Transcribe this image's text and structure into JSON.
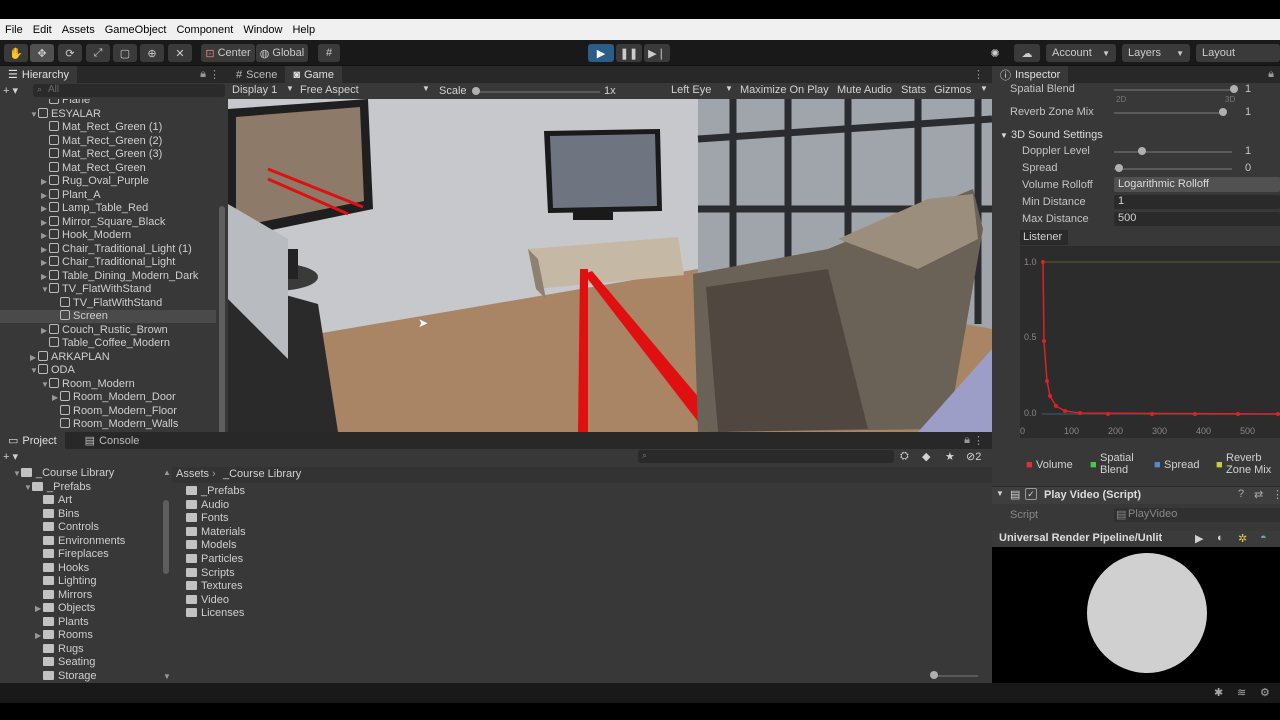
{
  "menu": {
    "items": [
      "File",
      "Edit",
      "Assets",
      "GameObject",
      "Component",
      "Window",
      "Help"
    ]
  },
  "toolbar": {
    "center_label": "Center",
    "global_label": "Global",
    "account_label": "Account",
    "layers_label": "Layers",
    "layout_label": "Layout"
  },
  "hierarchy": {
    "title": "Hierarchy",
    "search_placeholder": "All",
    "rows": [
      {
        "label": "Plane",
        "indent": 3,
        "arrow": ""
      },
      {
        "label": "ESYALAR",
        "indent": 2,
        "arrow": "▼"
      },
      {
        "label": "Mat_Rect_Green (1)",
        "indent": 3,
        "arrow": ""
      },
      {
        "label": "Mat_Rect_Green (2)",
        "indent": 3,
        "arrow": ""
      },
      {
        "label": "Mat_Rect_Green (3)",
        "indent": 3,
        "arrow": ""
      },
      {
        "label": "Mat_Rect_Green",
        "indent": 3,
        "arrow": ""
      },
      {
        "label": "Rug_Oval_Purple",
        "indent": 3,
        "arrow": "▶"
      },
      {
        "label": "Plant_A",
        "indent": 3,
        "arrow": "▶"
      },
      {
        "label": "Lamp_Table_Red",
        "indent": 3,
        "arrow": "▶"
      },
      {
        "label": "Mirror_Square_Black",
        "indent": 3,
        "arrow": "▶"
      },
      {
        "label": "Hook_Modern",
        "indent": 3,
        "arrow": "▶"
      },
      {
        "label": "Chair_Traditional_Light (1)",
        "indent": 3,
        "arrow": "▶"
      },
      {
        "label": "Chair_Traditional_Light",
        "indent": 3,
        "arrow": "▶"
      },
      {
        "label": "Table_Dining_Modern_Dark",
        "indent": 3,
        "arrow": "▶"
      },
      {
        "label": "TV_FlatWithStand",
        "indent": 3,
        "arrow": "▼"
      },
      {
        "label": "TV_FlatWithStand",
        "indent": 4,
        "arrow": ""
      },
      {
        "label": "Screen",
        "indent": 4,
        "arrow": ""
      },
      {
        "label": "Couch_Rustic_Brown",
        "indent": 3,
        "arrow": "▶"
      },
      {
        "label": "Table_Coffee_Modern",
        "indent": 3,
        "arrow": ""
      },
      {
        "label": "ARKAPLAN",
        "indent": 2,
        "arrow": "▶"
      },
      {
        "label": "ODA",
        "indent": 2,
        "arrow": "▼"
      },
      {
        "label": "Room_Modern",
        "indent": 3,
        "arrow": "▼"
      },
      {
        "label": "Room_Modern_Door",
        "indent": 4,
        "arrow": "▶"
      },
      {
        "label": "Room_Modern_Floor",
        "indent": 4,
        "arrow": ""
      },
      {
        "label": "Room_Modern_Walls",
        "indent": 4,
        "arrow": ""
      }
    ]
  },
  "game": {
    "scene_tab": "Scene",
    "game_tab": "Game",
    "display": "Display 1",
    "aspect": "Free Aspect",
    "scale_label": "Scale",
    "scale_value": "1x",
    "eye": "Left Eye",
    "maximize": "Maximize On Play",
    "mute": "Mute Audio",
    "stats": "Stats",
    "gizmos": "Gizmos"
  },
  "inspector": {
    "title": "Inspector",
    "spatial_blend_label": "Spatial Blend",
    "spatial_blend_value": "1",
    "spatial_2d": "2D",
    "spatial_3d": "3D",
    "reverb_label": "Reverb Zone Mix",
    "reverb_value": "1",
    "sound_settings": "3D Sound Settings",
    "doppler_label": "Doppler Level",
    "doppler_value": "1",
    "spread_label": "Spread",
    "spread_value": "0",
    "rolloff_label": "Volume Rolloff",
    "rolloff_value": "Logarithmic Rolloff",
    "min_label": "Min Distance",
    "min_value": "1",
    "max_label": "Max Distance",
    "max_value": "500",
    "listener": "Listener",
    "graph": {
      "y_ticks": [
        "1.0",
        "0.5",
        "0.0"
      ],
      "x_ticks": [
        "0",
        "100",
        "200",
        "300",
        "400",
        "500"
      ]
    },
    "legend": [
      "Volume",
      "Spatial Blend",
      "Spread",
      "Reverb Zone Mix"
    ],
    "legend_colors": [
      "#d33",
      "#4c4",
      "#58c",
      "#cc4"
    ],
    "script_title": "Play Video (Script)",
    "script_label": "Script",
    "script_value": "PlayVideo",
    "urp": "Universal Render Pipeline/Unlit"
  },
  "project": {
    "project_tab": "Project",
    "console_tab": "Console",
    "tree": [
      {
        "label": "_Course Library",
        "indent": 1,
        "arrow": "▼"
      },
      {
        "label": "_Prefabs",
        "indent": 2,
        "arrow": "▼"
      },
      {
        "label": "Art",
        "indent": 3,
        "arrow": ""
      },
      {
        "label": "Bins",
        "indent": 3,
        "arrow": ""
      },
      {
        "label": "Controls",
        "indent": 3,
        "arrow": ""
      },
      {
        "label": "Environments",
        "indent": 3,
        "arrow": ""
      },
      {
        "label": "Fireplaces",
        "indent": 3,
        "arrow": ""
      },
      {
        "label": "Hooks",
        "indent": 3,
        "arrow": ""
      },
      {
        "label": "Lighting",
        "indent": 3,
        "arrow": ""
      },
      {
        "label": "Mirrors",
        "indent": 3,
        "arrow": ""
      },
      {
        "label": "Objects",
        "indent": 3,
        "arrow": "▶"
      },
      {
        "label": "Plants",
        "indent": 3,
        "arrow": ""
      },
      {
        "label": "Rooms",
        "indent": 3,
        "arrow": "▶"
      },
      {
        "label": "Rugs",
        "indent": 3,
        "arrow": ""
      },
      {
        "label": "Seating",
        "indent": 3,
        "arrow": ""
      },
      {
        "label": "Storage",
        "indent": 3,
        "arrow": ""
      }
    ],
    "breadcrumb": [
      "Assets",
      "_Course Library"
    ],
    "hidden_count": "2",
    "files": [
      "_Prefabs",
      "Audio",
      "Fonts",
      "Materials",
      "Models",
      "Particles",
      "Scripts",
      "Textures",
      "Video",
      "Licenses"
    ]
  }
}
